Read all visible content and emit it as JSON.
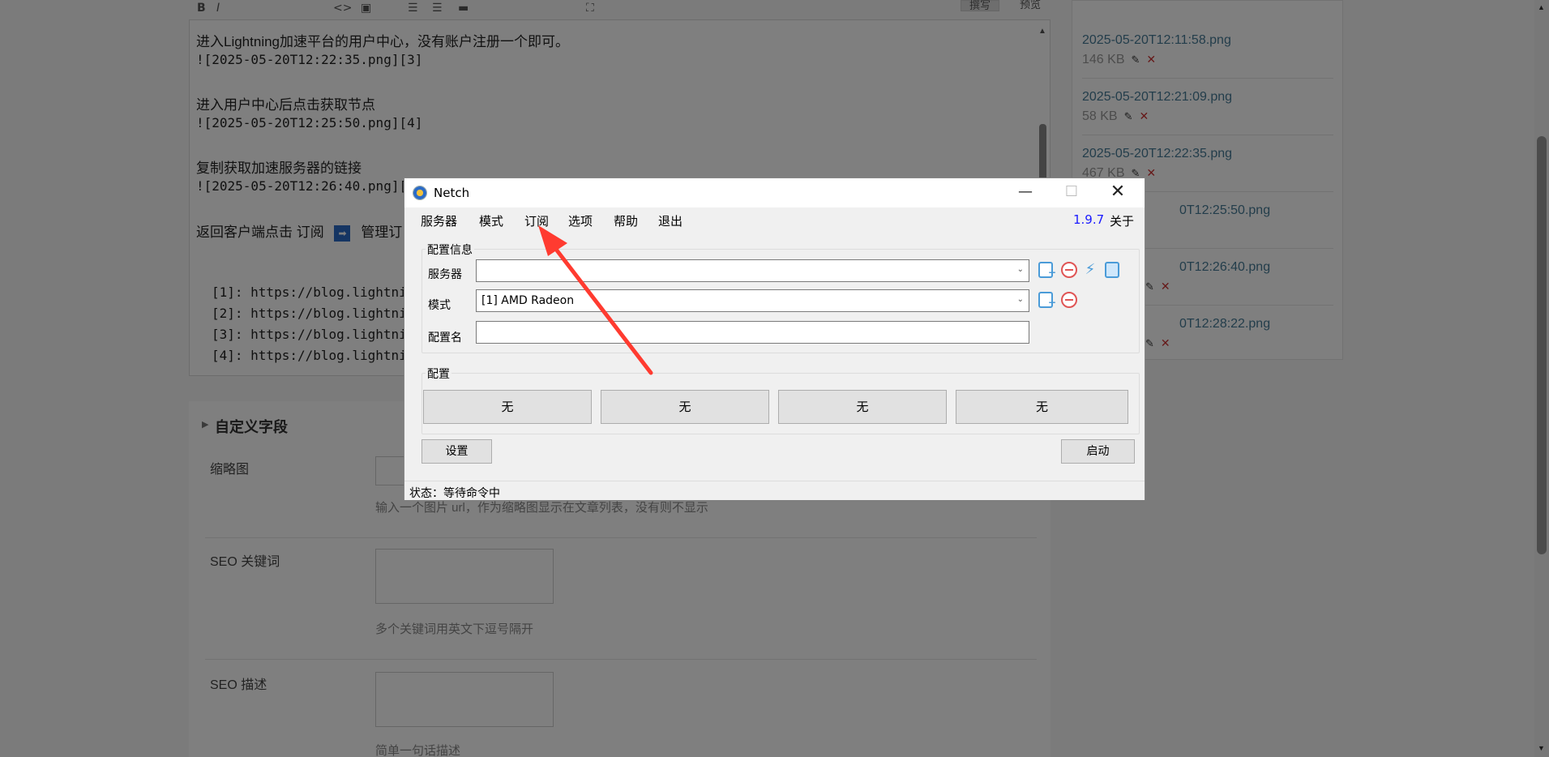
{
  "editor": {
    "lines": [
      {
        "text": "进入Lightning加速平台的用户中心，没有账户注册一个即可。"
      },
      {
        "text": "![2025-05-20T12:22:35.png][3]"
      },
      {
        "text": "进入用户中心后点击获取节点"
      },
      {
        "text": "![2025-05-20T12:25:50.png][4]"
      },
      {
        "text": "复制获取加速服务器的链接"
      },
      {
        "text": "![2025-05-20T12:26:40.png]["
      },
      {
        "text": "返回客户端点击 订阅"
      },
      {
        "text": "管理订"
      },
      {
        "text": "[1]: https://blog.lightni"
      },
      {
        "text": "[2]: https://blog.lightni"
      },
      {
        "text": "[3]: https://blog.lightni"
      },
      {
        "text": "[4]: https://blog.lightni"
      }
    ],
    "toolbar_buttons": [
      "撰写",
      "预览"
    ]
  },
  "custom_fields": {
    "title": "自定义字段",
    "fields": [
      {
        "label": "缩略图",
        "hint": "输入一个图片 url，作为缩略图显示在文章列表，没有则不显示"
      },
      {
        "label": "SEO 关键词",
        "hint": "多个关键词用英文下逗号隔开"
      },
      {
        "label": "SEO 描述",
        "hint": "简单一句话描述"
      }
    ]
  },
  "files": [
    {
      "name": "2025-05-20T12:11:58.png",
      "size": "146 KB"
    },
    {
      "name": "2025-05-20T12:21:09.png",
      "size": "58 KB"
    },
    {
      "name": "2025-05-20T12:22:35.png",
      "size": "467 KB"
    },
    {
      "name": "0T12:25:50.png",
      "size": ""
    },
    {
      "name": "0T12:26:40.png",
      "size": ""
    },
    {
      "name": "0T12:28:22.png",
      "size": ""
    }
  ],
  "netch": {
    "title": "Netch",
    "menu": [
      "服务器",
      "模式",
      "订阅",
      "选项",
      "帮助",
      "退出"
    ],
    "version": "1.9.7",
    "about": "关于",
    "config_info": {
      "legend": "配置信息",
      "server_label": "服务器",
      "server_value": "",
      "mode_label": "模式",
      "mode_value": "[1] AMD Radeon",
      "profile_name_label": "配置名",
      "profile_name_value": ""
    },
    "profiles": {
      "legend": "配置",
      "buttons": [
        "无",
        "无",
        "无",
        "无"
      ]
    },
    "settings_button": "设置",
    "start_button": "启动",
    "status": "状态：等待命令中",
    "icons": {
      "add": "add-server-icon",
      "remove": "remove-icon",
      "speed": "speedtest-icon",
      "copy": "copy-icon"
    }
  },
  "annotation": {
    "arrow_color": "#ff3b30"
  },
  "colors": {
    "overlay": "rgba(0,0,0,0.5)",
    "version": "#1a1aff",
    "link": "#467b96"
  }
}
